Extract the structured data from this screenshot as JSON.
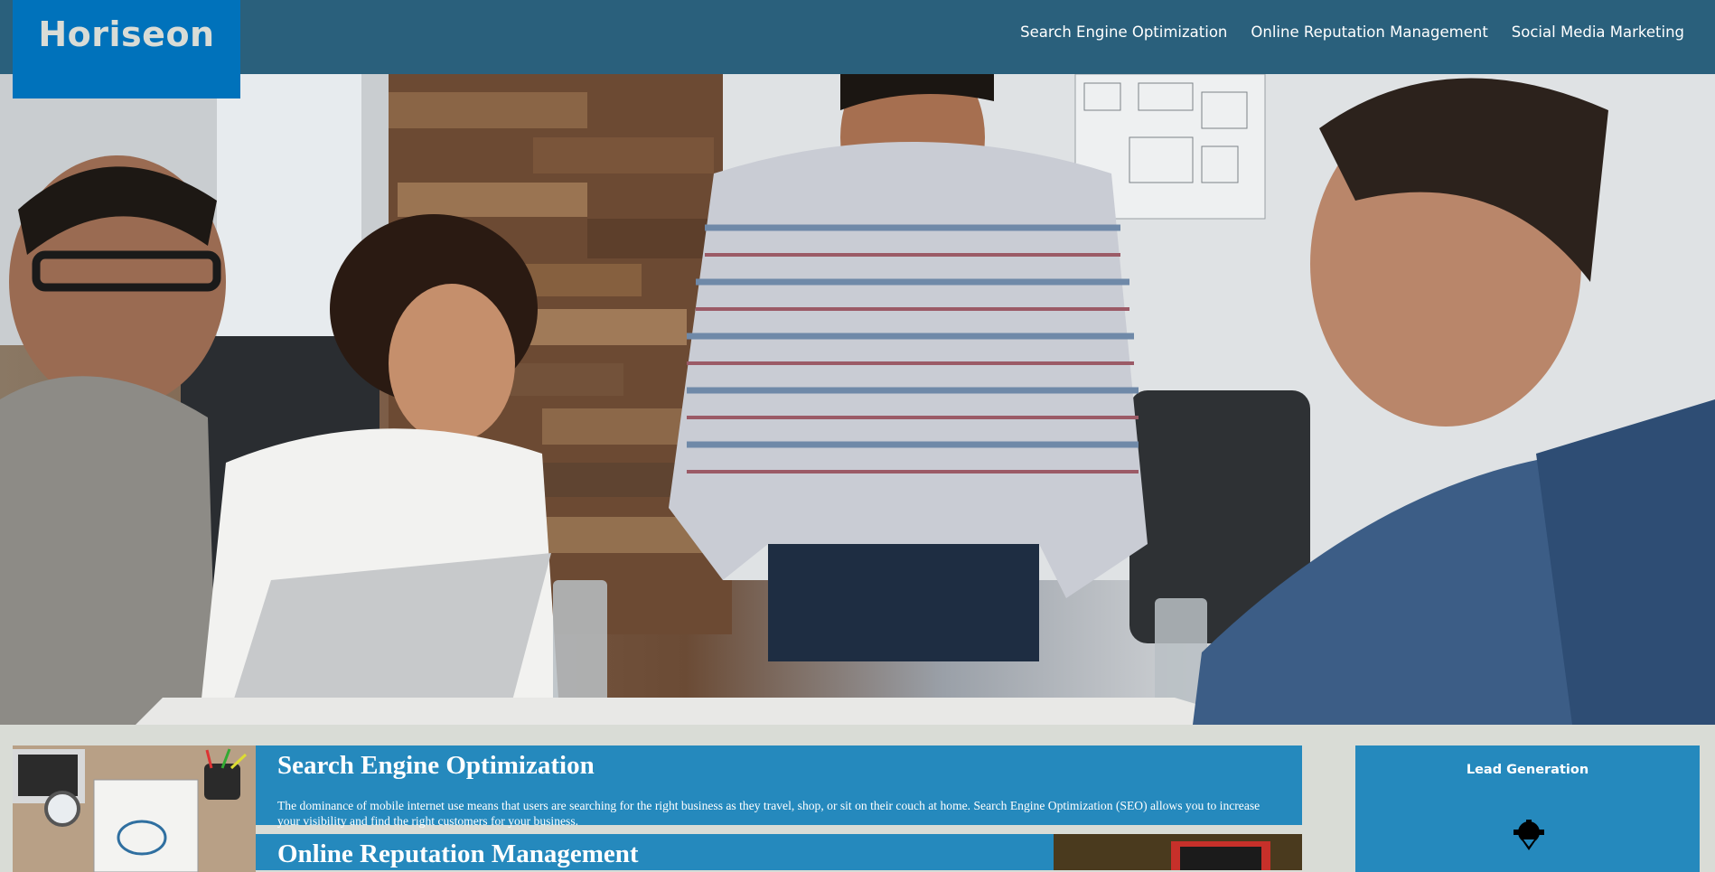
{
  "header": {
    "logo": "Horiseon",
    "nav": [
      {
        "label": "Search Engine Optimization"
      },
      {
        "label": "Online Reputation Management"
      },
      {
        "label": "Social Media Marketing"
      }
    ]
  },
  "hero": {
    "image": "team-meeting-photo"
  },
  "content": {
    "cards": [
      {
        "title": "Search Engine Optimization",
        "text": "The dominance of mobile internet use means that users are searching for the right business as they travel, shop, or sit on their couch at home. Search Engine Optimization (SEO) allows you to increase your visibility and find the right customers for your business.",
        "image": "seo-notebook-image"
      },
      {
        "title": "Online Reputation Management",
        "image": "reputation-laptop-image"
      }
    ]
  },
  "sidebar": {
    "title": "Lead Generation",
    "icon": "lead-generation-icon"
  }
}
